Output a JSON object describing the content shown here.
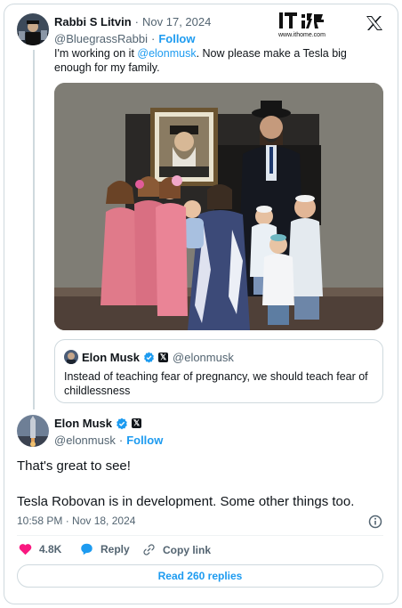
{
  "original_tweet": {
    "display_name": "Rabbi S Litvin",
    "separator": "·",
    "date": "Nov 17, 2024",
    "handle": "@BluegrassRabbi",
    "dot": "·",
    "follow_label": "Follow",
    "text_before": "I'm working on it ",
    "mention": "@elonmusk",
    "text_after": ". Now please make a Tesla big enough for my family."
  },
  "watermark": {
    "site": "www.ithome.com"
  },
  "quoted_tweet": {
    "display_name": "Elon Musk",
    "handle": "@elonmusk",
    "text": "Instead of teaching fear of pregnancy, we should teach fear of childlessness"
  },
  "reply_tweet": {
    "display_name": "Elon Musk",
    "handle": "@elonmusk",
    "dot": "·",
    "follow_label": "Follow",
    "line1": "That's great to see!",
    "line2": "Tesla Robovan is in development. Some other things too.",
    "timestamp": "10:58 PM · Nov 18, 2024"
  },
  "actions": {
    "likes": "4.8K",
    "reply_label": "Reply",
    "copy_link_label": "Copy link",
    "read_replies_label": "Read 260 replies"
  },
  "colors": {
    "accent": "#1d9bf0",
    "like": "#f91880",
    "text": "#0f1419",
    "muted": "#536471"
  }
}
